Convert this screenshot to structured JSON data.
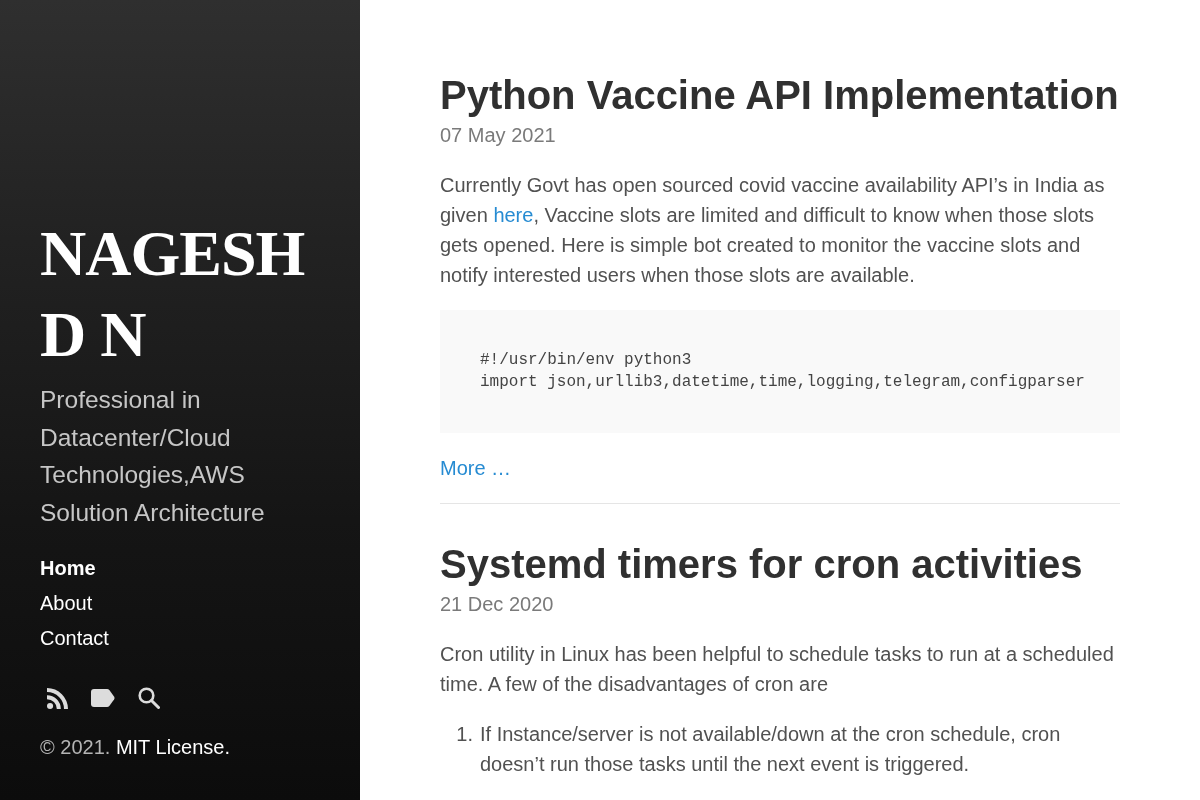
{
  "sidebar": {
    "title": "NAGESH D N",
    "tagline": "Professional in Datacenter/Cloud Technologies,AWS Solution Architecture",
    "nav": [
      {
        "label": "Home",
        "selected": true
      },
      {
        "label": "About",
        "selected": false
      },
      {
        "label": "Contact",
        "selected": false
      }
    ],
    "footer": {
      "text": "© 2021.",
      "link": "MIT License."
    }
  },
  "posts": [
    {
      "title": "Python Vaccine API Implementation",
      "date": "07 May 2021",
      "body": [
        {
          "kind": "paragraph",
          "parts": [
            {
              "kind": "text",
              "text": "Currently Govt has open sourced covid vaccine availability API’s in India as given "
            },
            {
              "kind": "link",
              "text": "here"
            },
            {
              "kind": "text",
              "text": ", Vaccine slots are limited and difficult to know when those slots gets opened. Here is simple bot created to monitor the vaccine slots and notify interested users when those slots are available."
            }
          ]
        },
        {
          "kind": "code",
          "lines": [
            "#!/usr/bin/env python3",
            "import json,urllib3,datetime,time,logging,telegram,configparser"
          ]
        },
        {
          "kind": "more",
          "label": "More …"
        }
      ]
    },
    {
      "title": "Systemd timers for cron activities",
      "date": "21 Dec 2020",
      "body": [
        {
          "kind": "paragraph",
          "parts": [
            {
              "kind": "text",
              "text": "Cron utility in Linux has been helpful to schedule tasks to run at a scheduled time. A few of the disadvantages of cron are"
            }
          ]
        },
        {
          "kind": "list",
          "items": [
            {
              "number": "1.",
              "text": "If Instance/server is not available/down at the cron schedule, cron doesn’t run those tasks until the next event is triggered."
            }
          ]
        }
      ]
    }
  ]
}
